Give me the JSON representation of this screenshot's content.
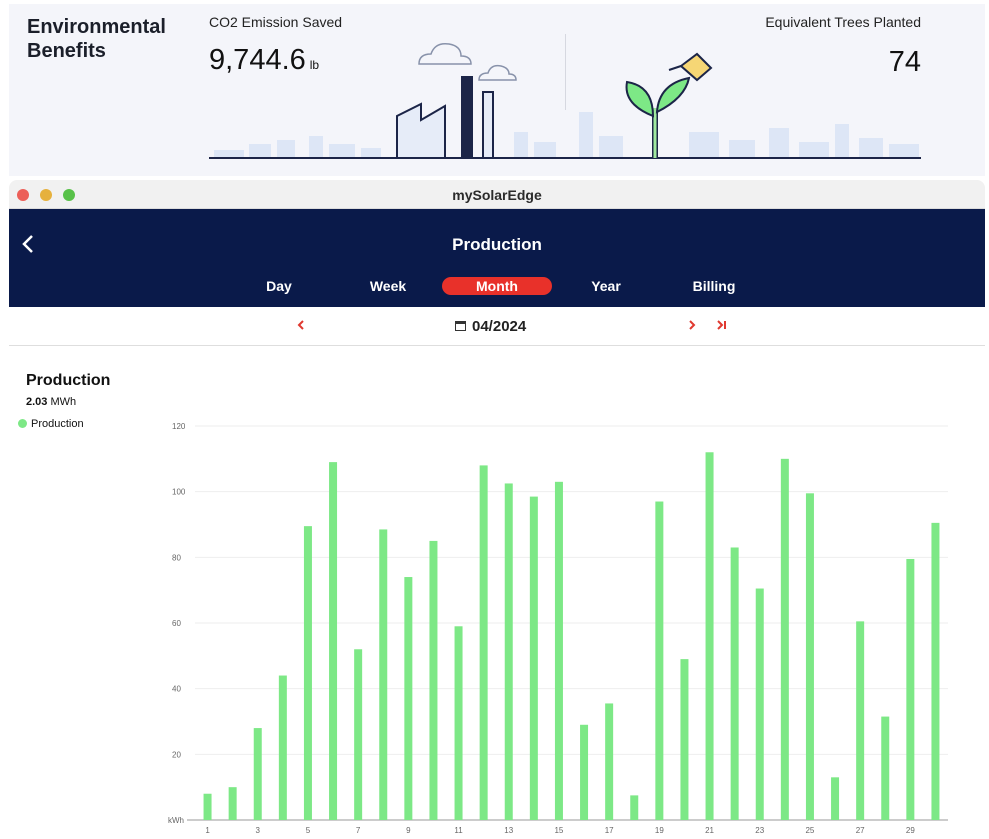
{
  "environmental": {
    "title": "Environmental Benefits",
    "co2_label": "CO2 Emission Saved",
    "co2_value": "9,744.6",
    "co2_unit": "lb",
    "trees_label": "Equivalent Trees Planted",
    "trees_value": "74",
    "illustrations": [
      "factory-clouds-illustration",
      "watering-plant-illustration"
    ]
  },
  "window": {
    "title": "mySolarEdge"
  },
  "header": {
    "back_icon": "chevron-left-icon",
    "title": "Production",
    "tabs": [
      {
        "label": "Day",
        "active": false
      },
      {
        "label": "Week",
        "active": false
      },
      {
        "label": "Month",
        "active": true
      },
      {
        "label": "Year",
        "active": false
      },
      {
        "label": "Billing",
        "active": false
      }
    ]
  },
  "datebar": {
    "prev_icon": "chevron-left-icon",
    "date": "04/2024",
    "next_icon": "chevron-right-icon",
    "last_icon": "skip-to-end-icon"
  },
  "summary": {
    "title": "Production",
    "total_value": "2.03",
    "total_unit": "MWh",
    "legend_label": "Production"
  },
  "colors": {
    "header_bg": "#0a1a4a",
    "accent": "#e8312a",
    "bar": "#7de886"
  },
  "chart_data": {
    "type": "bar",
    "ylabel": "kWh",
    "ylim": [
      0,
      120
    ],
    "yticks": [
      20,
      40,
      60,
      80,
      100,
      120
    ],
    "x_tick_labels": [
      "1",
      "3",
      "5",
      "7",
      "9",
      "11",
      "13",
      "15",
      "17",
      "19",
      "21",
      "23",
      "25",
      "27",
      "29"
    ],
    "categories": [
      "1",
      "2",
      "3",
      "4",
      "5",
      "6",
      "7",
      "8",
      "9",
      "10",
      "11",
      "12",
      "13",
      "14",
      "15",
      "16",
      "17",
      "18",
      "19",
      "20",
      "21",
      "22",
      "23",
      "24",
      "25",
      "26",
      "27",
      "28",
      "29",
      "30"
    ],
    "series": [
      {
        "name": "Production",
        "values": [
          8,
          10,
          28,
          44,
          89.5,
          109,
          52,
          88.5,
          74,
          85,
          59,
          108,
          102.5,
          98.5,
          103,
          29,
          35.5,
          7.5,
          97,
          49,
          112,
          83,
          70.5,
          110,
          99.5,
          13,
          60.5,
          31.5,
          79.5,
          90.5
        ]
      }
    ],
    "grid": true
  }
}
